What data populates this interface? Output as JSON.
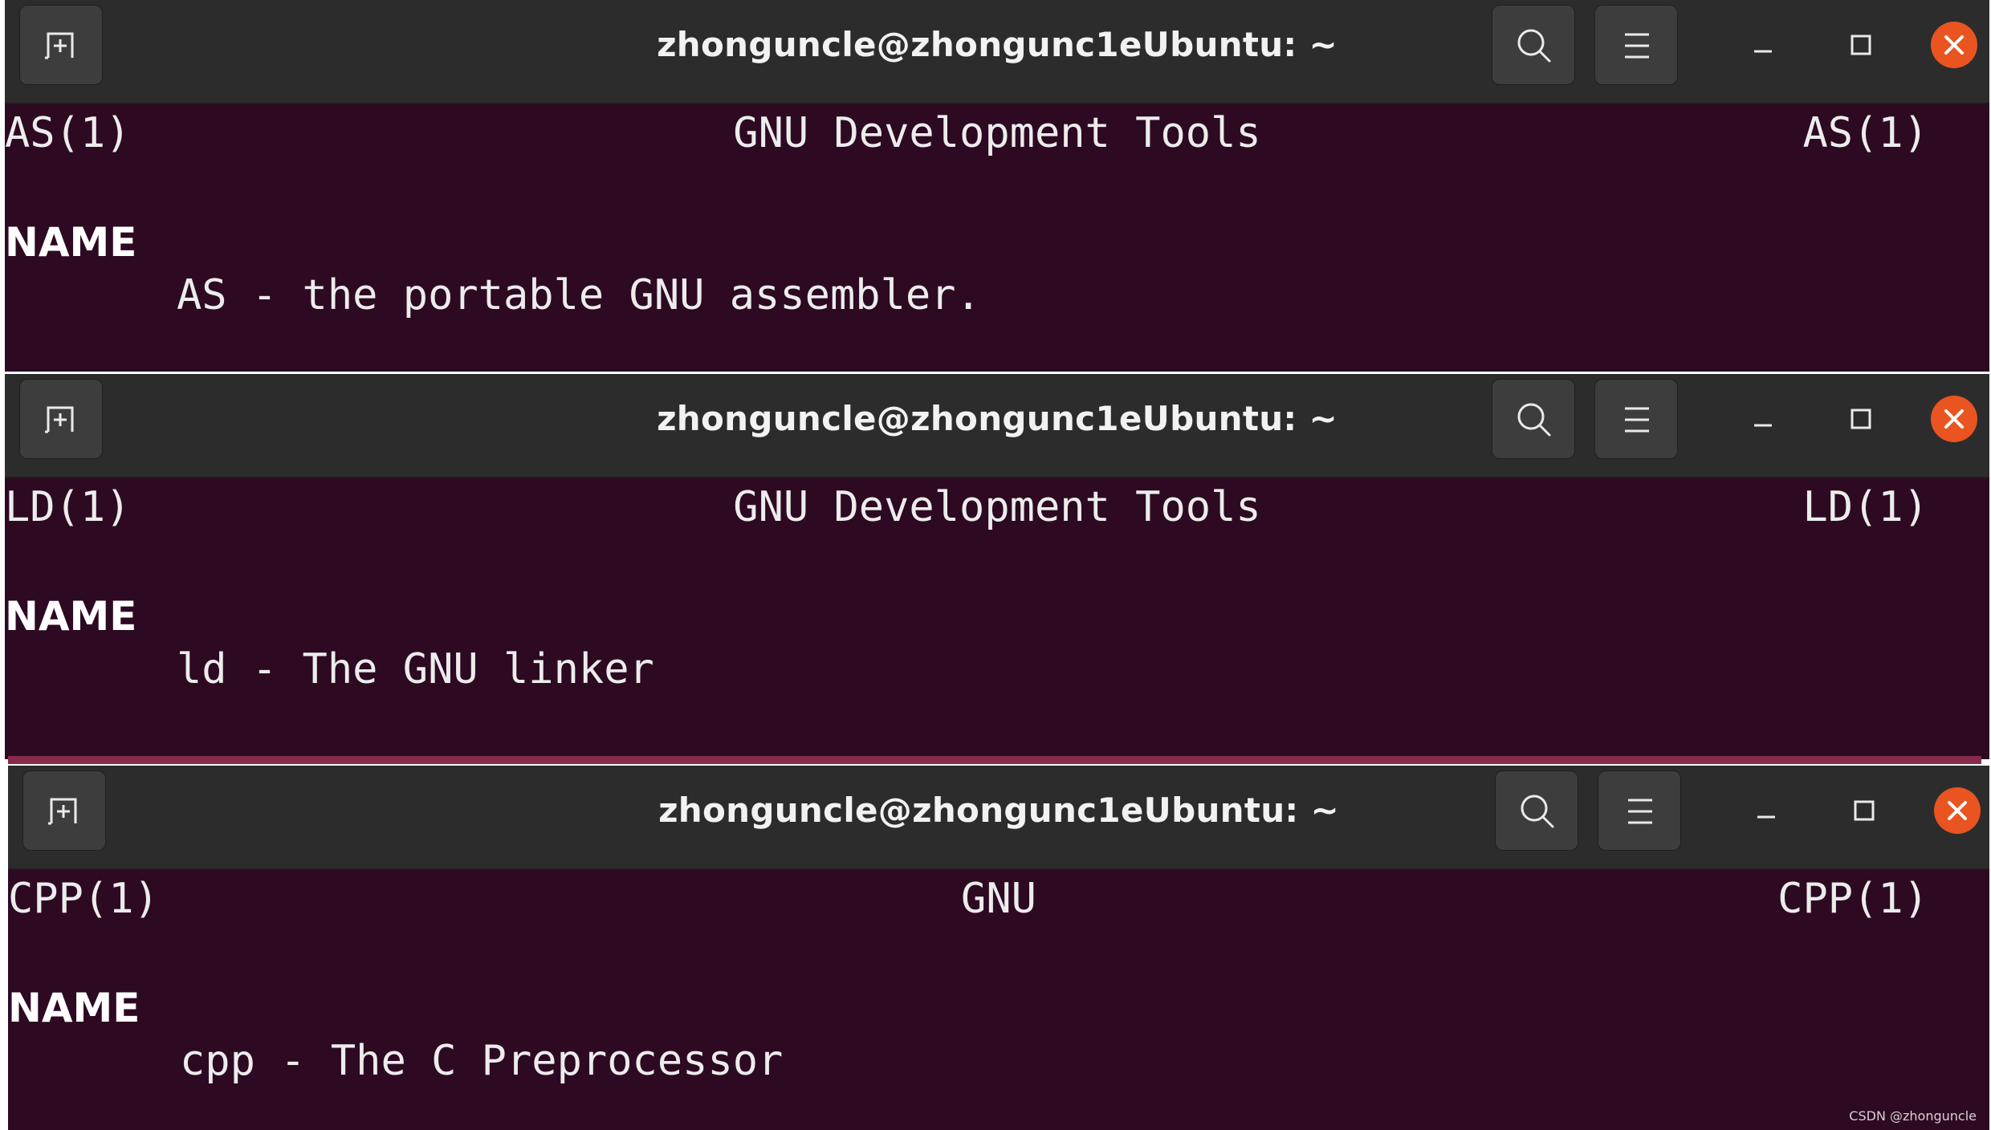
{
  "windows": [
    {
      "title": "zhonguncle@zhongunc1eUbuntu: ~",
      "header_left": "AS(1)",
      "header_center": "GNU Development Tools",
      "header_right": "AS(1)",
      "section": "NAME",
      "description": "AS - the portable GNU assembler."
    },
    {
      "title": "zhonguncle@zhongunc1eUbuntu: ~",
      "header_left": "LD(1)",
      "header_center": "GNU Development Tools",
      "header_right": "LD(1)",
      "section": "NAME",
      "description": "ld - The GNU linker"
    },
    {
      "title": "zhonguncle@zhongunc1eUbuntu: ~",
      "header_left": "CPP(1)",
      "header_center": "GNU",
      "header_right": "CPP(1)",
      "section": "NAME",
      "description": "cpp - The C Preprocessor"
    }
  ],
  "icons": {
    "new_tab": "new-tab-icon",
    "search": "search-icon",
    "menu": "hamburger-menu-icon",
    "minimize": "minimize-icon",
    "maximize": "maximize-icon",
    "close": "close-icon"
  },
  "colors": {
    "titlebar": "#2c2c2c",
    "terminal_bg": "#2d0a22",
    "close_button": "#e95420"
  },
  "watermark": "CSDN @zhonguncle"
}
